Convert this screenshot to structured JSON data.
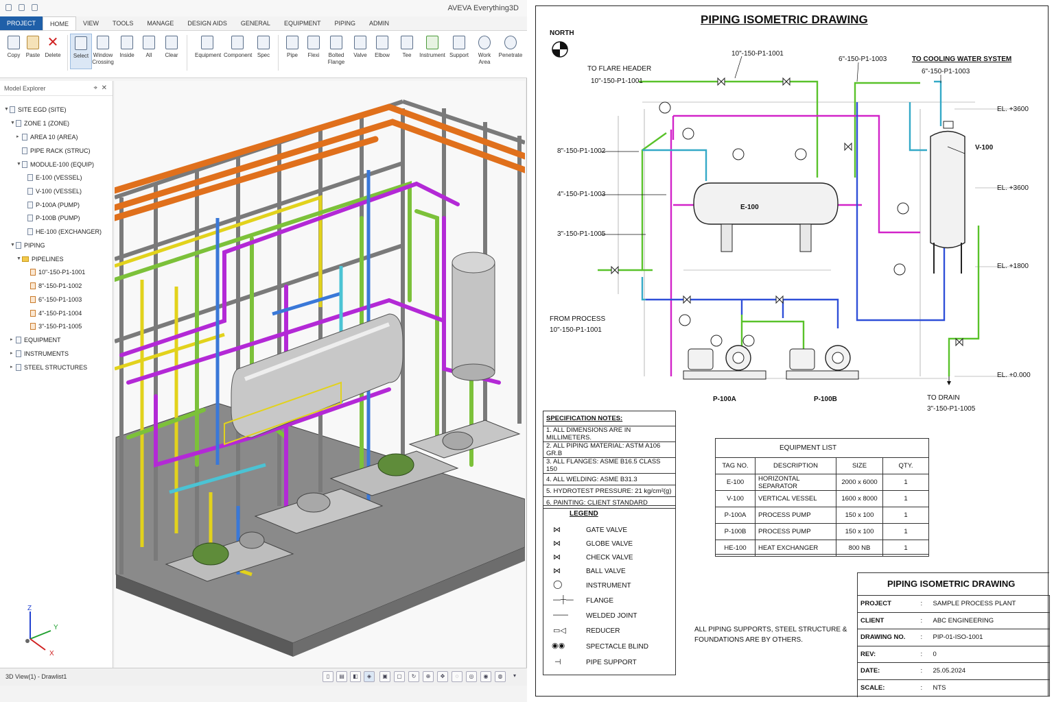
{
  "app": {
    "title": "AVEVA Everything3D",
    "tabs": [
      "PROJECT",
      "HOME",
      "VIEW",
      "TOOLS",
      "MANAGE",
      "DESIGN AIDS",
      "GENERAL",
      "EQUIPMENT",
      "PIPING",
      "ADMIN"
    ],
    "active_tab": "HOME",
    "ribbon": {
      "copy": "Copy",
      "paste": "Paste",
      "delete": "Delete",
      "select": "Select",
      "window_crossing_1": "Window",
      "window_crossing_2": "Crossing",
      "inside": "Inside",
      "all": "All",
      "clear": "Clear",
      "equipment": "Equipment",
      "component": "Component",
      "spec": "Spec",
      "pipe": "Pipe",
      "flexi": "Flexi",
      "bolted_flange_1": "Bolted",
      "bolted_flange_2": "Flange",
      "valve": "Valve",
      "elbow": "Elbow",
      "tee": "Tee",
      "instrument": "Instrument",
      "support": "Support",
      "work_area": "Work Area",
      "penetrate": "Penetrate"
    },
    "explorer": {
      "title": "Model Explorer",
      "pin": "⌖",
      "close": "✕",
      "nodes": [
        "SITE EGD (SITE)",
        "ZONE 1 (ZONE)",
        "AREA 10 (AREA)",
        "PIPE RACK (STRUC)",
        "MODULE-100 (EQUIP)",
        "E-100 (VESSEL)",
        "V-100 (VESSEL)",
        "P-100A (PUMP)",
        "P-100B (PUMP)",
        "HE-100 (EXCHANGER)",
        "PIPING",
        "PIPELINES",
        "10\"-150-P1-1001",
        "8\"-150-P1-1002",
        "6\"-150-P1-1003",
        "4\"-150-P1-1004",
        "3\"-150-P1-1005",
        "EQUIPMENT",
        "INSTRUMENTS",
        "STEEL STRUCTURES"
      ]
    },
    "status": "3D View(1) - Drawlist1",
    "axes": {
      "z": "Z",
      "y": "Y",
      "x": "X"
    },
    "colors": {
      "accent": "#1f5fa8",
      "pipe_orange": "#e0701c",
      "pipe_green": "#7cc13a",
      "pipe_magenta": "#b329d6",
      "pipe_blue": "#3a78d8",
      "pipe_yellow": "#e2d21c"
    }
  },
  "drawing": {
    "title": "PIPING ISOMETRIC DRAWING",
    "north": "NORTH",
    "labels": {
      "to_flare": "TO FLARE HEADER",
      "line_flare": "10\"-150-P1-1001",
      "line_top": "10\"-150-P1-1001",
      "line_6_1003": "6\"-150-P1-1003",
      "to_cooling": "TO COOLING WATER SYSTEM",
      "line_cooling": "6\"-150-P1-1003",
      "line_8": "8\"-150-P1-1002",
      "line_4": "4\"-150-P1-1003",
      "line_3": "3\"-150-P1-1005",
      "from_process": "FROM PROCESS",
      "line_process": "10\"-150-P1-1001",
      "to_drain": "TO DRAIN",
      "line_drain": "3\"-150-P1-1005",
      "e100": "E-100",
      "v100": "V-100",
      "p100a": "P-100A",
      "p100b": "P-100B",
      "el_3600a": "EL. +3600",
      "el_3600b": "EL. +3600",
      "el_1800": "EL. +1800",
      "el_0": "EL. +0.000"
    },
    "spec_notes": {
      "title": "SPECIFICATION NOTES:",
      "items": [
        "1. ALL DIMENSIONS ARE IN MILLIMETERS.",
        "2. ALL PIPING MATERIAL: ASTM A106 GR.B",
        "3. ALL FLANGES: ASME B16.5 CLASS 150",
        "4. ALL WELDING: ASME B31.3",
        "5. HYDROTEST PRESSURE: 21 kg/cm²(g)",
        "6. PAINTING: CLIENT STANDARD"
      ]
    },
    "legend": {
      "title": "LEGEND",
      "items": [
        "GATE VALVE",
        "GLOBE VALVE",
        "CHECK VALVE",
        "BALL VALVE",
        "INSTRUMENT",
        "FLANGE",
        "WELDED JOINT",
        "REDUCER",
        "SPECTACLE BLIND",
        "PIPE SUPPORT"
      ]
    },
    "equipment_list": {
      "title": "EQUIPMENT LIST",
      "headers": [
        "TAG NO.",
        "DESCRIPTION",
        "SIZE",
        "QTY."
      ],
      "rows": [
        [
          "E-100",
          "HORIZONTAL SEPARATOR",
          "2000 x 6000",
          "1"
        ],
        [
          "V-100",
          "VERTICAL VESSEL",
          "1600 x 8000",
          "1"
        ],
        [
          "P-100A",
          "PROCESS PUMP",
          "150 x 100",
          "1"
        ],
        [
          "P-100B",
          "PROCESS PUMP",
          "150 x 100",
          "1"
        ],
        [
          "HE-100",
          "HEAT EXCHANGER",
          "800 NB",
          "1"
        ]
      ]
    },
    "note": [
      "ALL PIPING SUPPORTS, STEEL STRUCTURE &",
      "FOUNDATIONS ARE BY OTHERS."
    ],
    "title_block": {
      "title": "PIPING ISOMETRIC DRAWING",
      "rows": [
        [
          "PROJECT",
          ":",
          "SAMPLE PROCESS PLANT"
        ],
        [
          "CLIENT",
          ":",
          "ABC ENGINEERING"
        ],
        [
          "DRAWING NO.",
          ":",
          "PIP-01-ISO-1001"
        ],
        [
          "REV:",
          ":",
          "0"
        ],
        [
          "DATE:",
          ":",
          "25.05.2024"
        ],
        [
          "SCALE:",
          ":",
          "NTS"
        ]
      ]
    }
  }
}
